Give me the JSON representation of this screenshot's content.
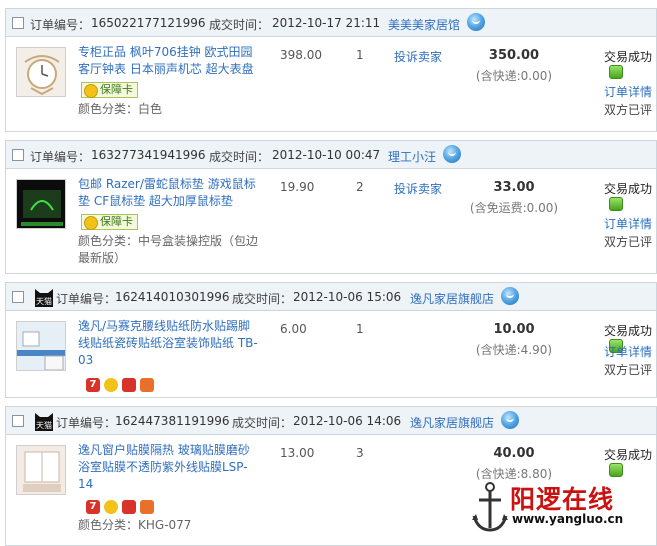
{
  "labels": {
    "order_no": "订单编号：",
    "deal_time": "成交时间：",
    "complain": "投诉卖家",
    "trade_success": "交易成功",
    "order_detail": "订单详情",
    "both_rated": "双方已评",
    "guarantee": "保障卡",
    "color_class": "颜色分类："
  },
  "orders": [
    {
      "order_no": "165022177121996",
      "time": "2012-10-17 21:11",
      "shop": "美美美家居馆",
      "title": "专柜正品 枫叶706挂钟 欧式田园客厅钟表 日本丽声机芯 超大表盘",
      "variant": "白色",
      "price": "398.00",
      "qty": "1",
      "total": "350.00",
      "shipping": "(含快递:0.00)"
    },
    {
      "order_no": "163277341941996",
      "time": "2012-10-10 00:47",
      "shop": "理工小汪",
      "title": "包邮 Razer/雷蛇鼠标垫 游戏鼠标垫 CF鼠标垫 超大加厚鼠标垫",
      "variant": "中号盒装操控版（包边最新版）",
      "price": "19.90",
      "qty": "2",
      "total": "33.00",
      "shipping": "(含免运费:0.00)"
    },
    {
      "order_no": "162414010301996",
      "time": "2012-10-06 15:06",
      "shop": "逸凡家居旗舰店",
      "title": "逸凡/马赛克腰线贴纸防水贴踢脚线贴纸瓷砖贴纸浴室装饰贴纸 TB-03",
      "price": "6.00",
      "qty": "1",
      "total": "10.00",
      "shipping": "(含快递:4.90)",
      "tmall_text": "天猫"
    },
    {
      "order_no": "162447381191996",
      "time": "2012-10-06 14:06",
      "shop": "逸凡家居旗舰店",
      "title": "逸凡窗户贴膜隔热 玻璃贴膜磨砂浴室贴膜不透防紫外线贴膜LSP-14",
      "variant": "KHG-077",
      "price": "13.00",
      "qty": "3",
      "total": "40.00",
      "shipping": "(含快递:8.80)",
      "tmall_text": "天猫"
    }
  ],
  "watermark": {
    "text": "阳逻在线",
    "url": "www.yangluo.cn"
  },
  "colors": {
    "header_bg": "#eef3f8",
    "link": "#2f6fbe",
    "watermark_red": "#cc1111"
  }
}
